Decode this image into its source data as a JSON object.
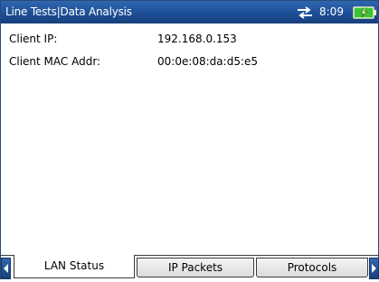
{
  "header": {
    "title": "Line Tests|Data Analysis",
    "time": "8:09",
    "icons": {
      "connection": "connection-arrows-icon",
      "battery": "battery-charging-icon"
    },
    "colors": {
      "titlebar": "#1d4f96",
      "battery": "#3ec43a"
    }
  },
  "content": {
    "client_ip_label": "Client IP:",
    "client_ip_value": "192.168.0.153",
    "client_mac_label": "Client MAC Addr:",
    "client_mac_value": "00:0e:08:da:d5:e5"
  },
  "tabs": [
    {
      "label": "LAN Status",
      "active": true
    },
    {
      "label": "IP Packets",
      "active": false
    },
    {
      "label": "Protocols",
      "active": false
    }
  ]
}
